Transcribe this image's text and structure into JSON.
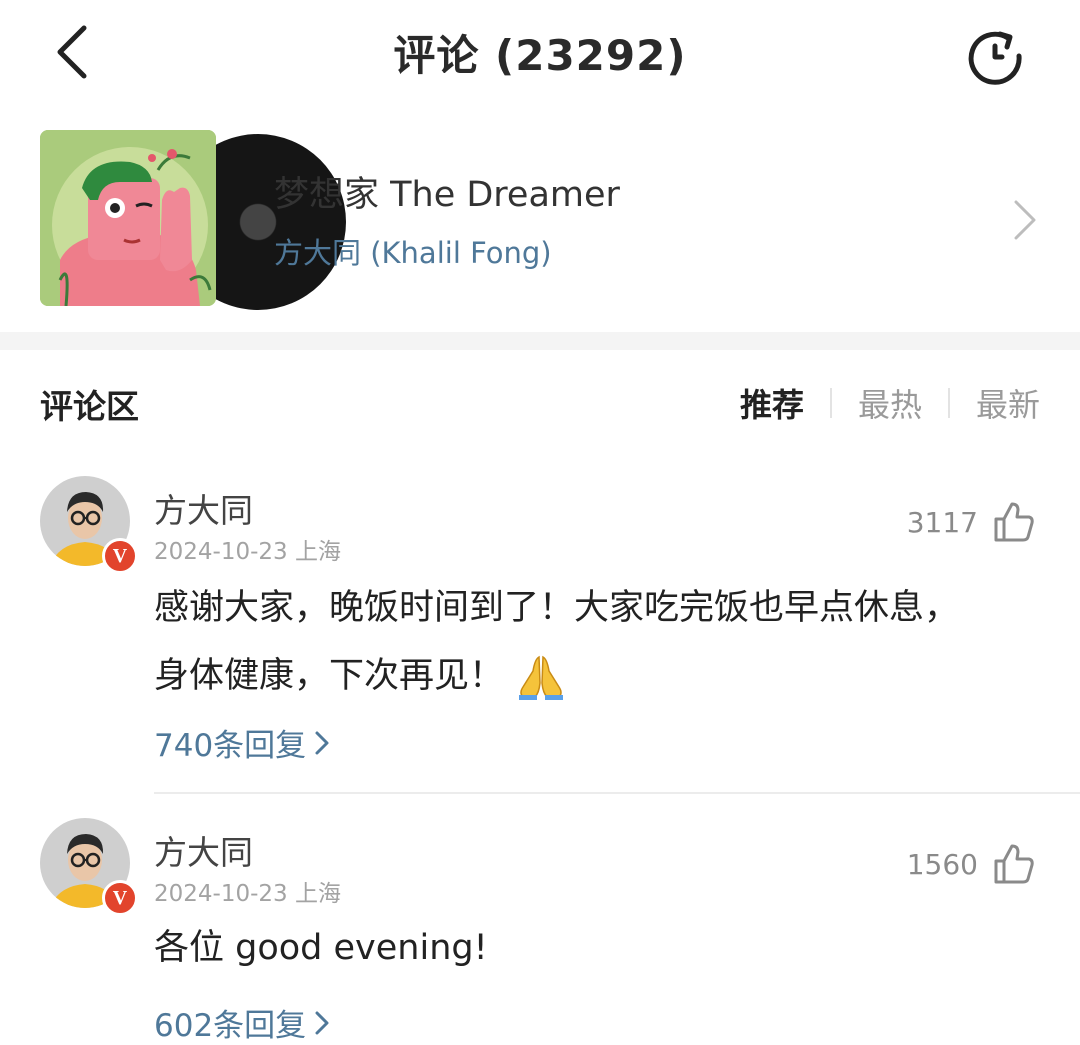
{
  "header": {
    "title": "评论 (23292)",
    "back_icon": "chevron-left-icon",
    "refresh_icon": "refresh-icon"
  },
  "song": {
    "title": "梦想家 The Dreamer",
    "artist": "方大同 (Khalil Fong)"
  },
  "comments_section": {
    "title": "评论区",
    "sort_tabs": [
      {
        "label": "推荐",
        "active": true
      },
      {
        "label": "最热",
        "active": false
      },
      {
        "label": "最新",
        "active": false
      }
    ]
  },
  "comments": [
    {
      "username": "方大同",
      "date": "2024-10-23",
      "location": "上海",
      "likes": "3117",
      "text_line1": "感谢大家，晚饭时间到了！大家吃完饭也早点休息，",
      "text_line2": "身体健康，下次再见！",
      "emoji": "folded-hands",
      "replies": "740条回复",
      "verified": true
    },
    {
      "username": "方大同",
      "date": "2024-10-23",
      "location": "上海",
      "likes": "1560",
      "text_line1": "各位 good evening!",
      "replies": "602条回复",
      "verified": true
    }
  ],
  "colors": {
    "link": "#4f7899",
    "badge": "#e2442c",
    "muted": "#a3a3a3"
  }
}
